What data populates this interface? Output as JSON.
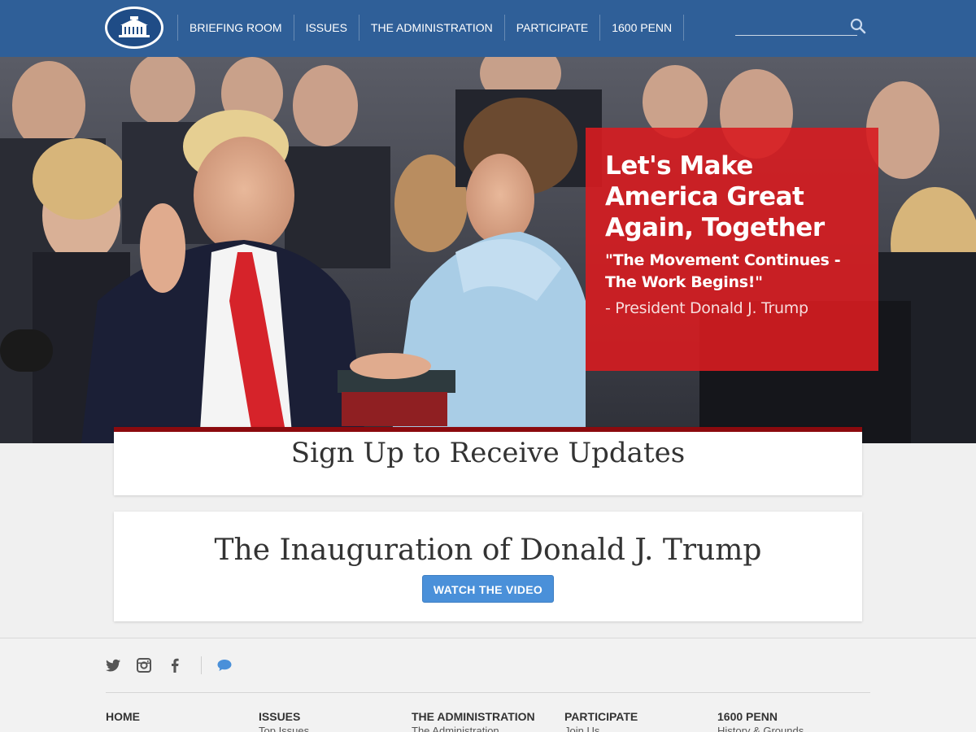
{
  "header": {
    "nav": [
      "BRIEFING ROOM",
      "ISSUES",
      "THE ADMINISTRATION",
      "PARTICIPATE",
      "1600 PENN"
    ],
    "search": {
      "value": "",
      "placeholder": ""
    }
  },
  "hero": {
    "title": "Let's Make America Great Again, Together",
    "quote": "\"The Movement Continues - The Work Begins!\"",
    "attribution": "- President Donald J. Trump"
  },
  "signup": {
    "title": "Sign Up to Receive Updates"
  },
  "video": {
    "title": "The Inauguration of Donald J. Trump",
    "button": "WATCH THE VIDEO"
  },
  "footer": {
    "social": [
      "twitter-icon",
      "instagram-icon",
      "facebook-icon",
      "chat-icon"
    ],
    "columns": [
      {
        "heading": "HOME",
        "link": ""
      },
      {
        "heading": "ISSUES",
        "link": "Top Issues"
      },
      {
        "heading": "THE ADMINISTRATION",
        "link": "The Administration"
      },
      {
        "heading": "PARTICIPATE",
        "link": "Join Us"
      },
      {
        "heading": "1600 PENN",
        "link": "History & Grounds"
      }
    ]
  },
  "colors": {
    "header_blue": "#2f5f98",
    "hero_card_red": "#d71c20",
    "card_accent": "#8b0a0e",
    "button_blue": "#4a90d9",
    "chat_icon_blue": "#4a90d9"
  }
}
